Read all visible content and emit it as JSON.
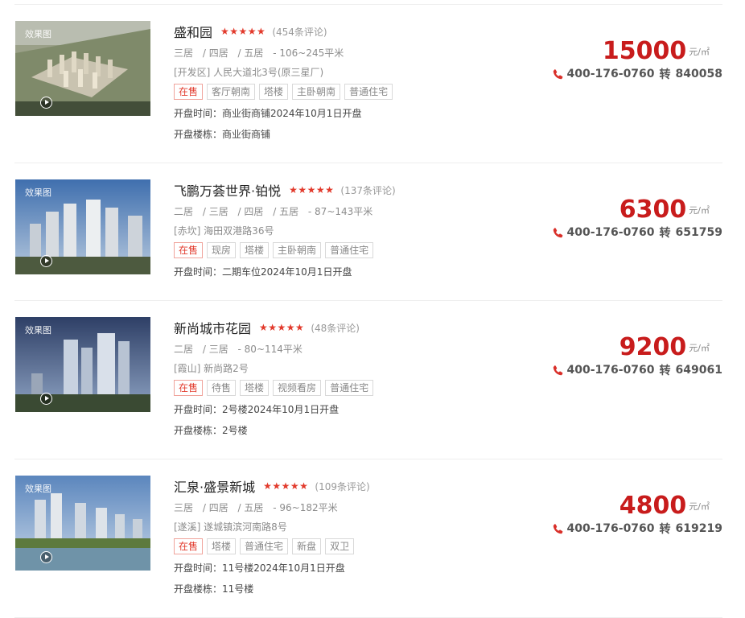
{
  "listings": [
    {
      "thumb_label": "效果图",
      "name": "盛和园",
      "stars": "★★★★★",
      "reviews": "(454条评论)",
      "rooms": [
        "三居",
        "/ 四居",
        "/ 五居"
      ],
      "area": "- 106~245平米",
      "address": "[开发区] 人民大道北3号(原三星厂)",
      "tags": [
        "在售",
        "客厅朝南",
        "塔楼",
        "主卧朝南",
        "普通住宅"
      ],
      "open_time": "开盘时间：商业街商铺2024年10月1日开盘",
      "open_building": "开盘楼栋：商业街商铺",
      "price": "15000",
      "unit": "元/㎡",
      "phone": "400-176-0760",
      "ext_label": "转",
      "ext": "840058"
    },
    {
      "thumb_label": "效果图",
      "name": "飞鹏万荟世界·铂悦",
      "stars": "★★★★★",
      "reviews": "(137条评论)",
      "rooms": [
        "二居",
        "/ 三居",
        "/ 四居",
        "/ 五居"
      ],
      "area": "- 87~143平米",
      "address": "[赤坎] 海田双港路36号",
      "tags": [
        "在售",
        "现房",
        "塔楼",
        "主卧朝南",
        "普通住宅"
      ],
      "open_time": "开盘时间：二期车位2024年10月1日开盘",
      "open_building": "",
      "price": "6300",
      "unit": "元/㎡",
      "phone": "400-176-0760",
      "ext_label": "转",
      "ext": "651759"
    },
    {
      "thumb_label": "效果图",
      "name": "新尚城市花园",
      "stars": "★★★★★",
      "reviews": "(48条评论)",
      "rooms": [
        "二居",
        "/ 三居"
      ],
      "area": "- 80~114平米",
      "address": "[霞山] 新尚路2号",
      "tags": [
        "在售",
        "待售",
        "塔楼",
        "视频看房",
        "普通住宅"
      ],
      "open_time": "开盘时间：2号楼2024年10月1日开盘",
      "open_building": "开盘楼栋：2号楼",
      "price": "9200",
      "unit": "元/㎡",
      "phone": "400-176-0760",
      "ext_label": "转",
      "ext": "649061"
    },
    {
      "thumb_label": "效果图",
      "name": "汇泉·盛景新城",
      "stars": "★★★★★",
      "reviews": "(109条评论)",
      "rooms": [
        "三居",
        "/ 四居",
        "/ 五居"
      ],
      "area": "- 96~182平米",
      "address": "[遂溪] 遂城镇滨河南路8号",
      "tags": [
        "在售",
        "塔楼",
        "普通住宅",
        "新盘",
        "双卫"
      ],
      "open_time": "开盘时间：11号楼2024年10月1日开盘",
      "open_building": "开盘楼栋：11号楼",
      "price": "4800",
      "unit": "元/㎡",
      "phone": "400-176-0760",
      "ext_label": "转",
      "ext": "619219"
    }
  ],
  "colors": {
    "accent_red": "#c81c1c",
    "star_red": "#e23a2c",
    "text_gray": "#8c8c8c"
  }
}
